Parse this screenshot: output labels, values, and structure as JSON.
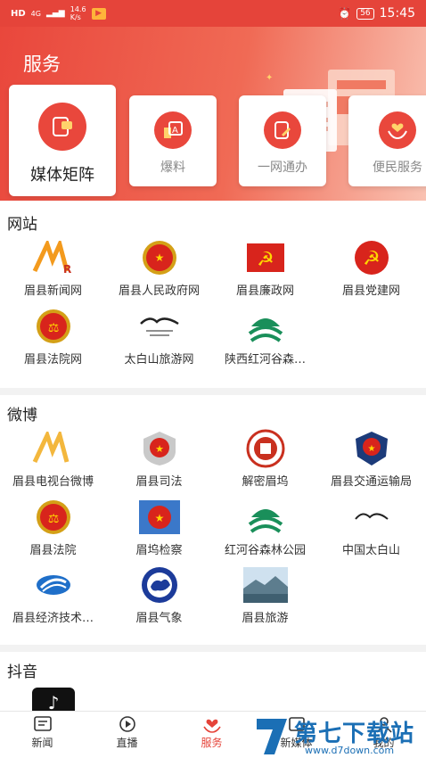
{
  "status_bar": {
    "network": "HD",
    "signal": "4G",
    "speed_value": "14.6",
    "speed_unit": "K/s",
    "battery": "56",
    "time": "15:45"
  },
  "header": {
    "title": "服务"
  },
  "services": [
    {
      "label": "媒体矩阵"
    },
    {
      "label": "爆料"
    },
    {
      "label": "一网通办"
    },
    {
      "label": "便民服务"
    }
  ],
  "websites": {
    "title": "网站",
    "items": [
      {
        "name": "眉县新闻网"
      },
      {
        "name": "眉县人民政府网"
      },
      {
        "name": "眉县廉政网"
      },
      {
        "name": "眉县党建网"
      },
      {
        "name": "眉县法院网"
      },
      {
        "name": "太白山旅游网"
      },
      {
        "name": "陕西红河谷森…"
      }
    ]
  },
  "weibo": {
    "title": "微博",
    "items": [
      {
        "name": "眉县电视台微博"
      },
      {
        "name": "眉县司法"
      },
      {
        "name": "解密眉坞"
      },
      {
        "name": "眉县交通运输局"
      },
      {
        "name": "眉县法院"
      },
      {
        "name": "眉坞检察"
      },
      {
        "name": "红河谷森林公园"
      },
      {
        "name": "中国太白山"
      },
      {
        "name": "眉县经济技术…"
      },
      {
        "name": "眉县气象"
      },
      {
        "name": "眉县旅游"
      }
    ]
  },
  "douyin": {
    "title": "抖音"
  },
  "bottom_nav": [
    {
      "label": "新闻"
    },
    {
      "label": "直播"
    },
    {
      "label": "服务"
    },
    {
      "label": "新媒体"
    },
    {
      "label": "我的"
    }
  ],
  "watermark": {
    "text": "第七下载站",
    "url": "www.d7down.com"
  },
  "colors": {
    "accent": "#e5443a",
    "background": "#f2f2f2"
  }
}
